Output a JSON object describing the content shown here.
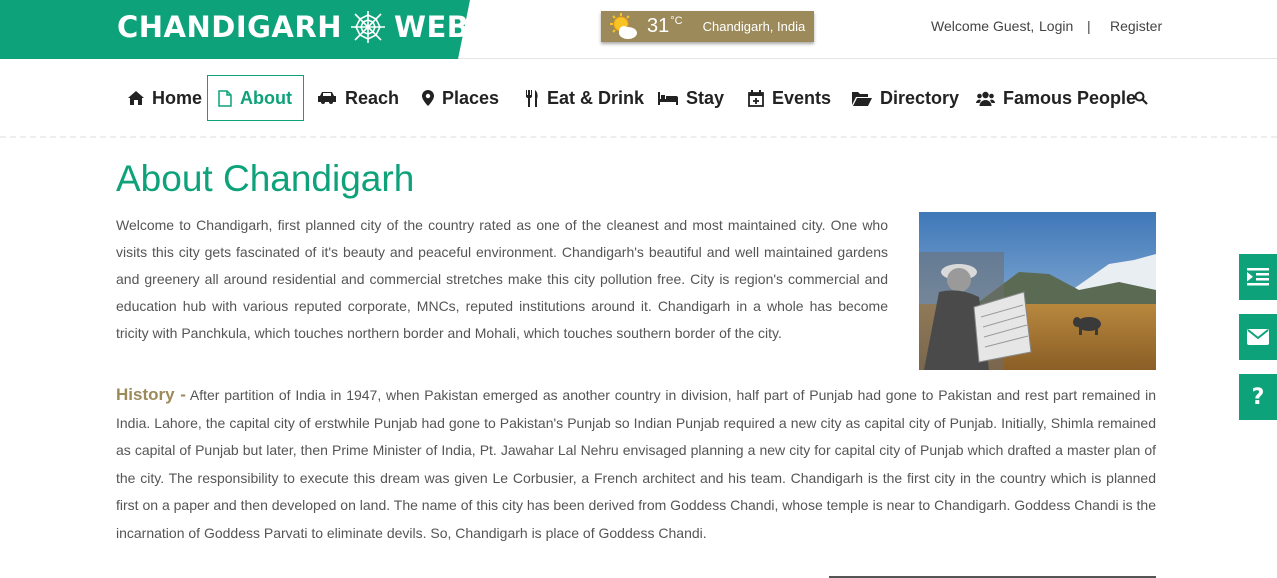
{
  "header": {
    "logo_left": "CHANDIGARH",
    "logo_right": "WEB",
    "weather": {
      "temperature": "31",
      "unit": "°C",
      "location": "Chandigarh, India"
    },
    "welcome": "Welcome Guest,",
    "login": "Login",
    "separator": "|",
    "register": "Register"
  },
  "nav": {
    "items": [
      {
        "label": "Home",
        "icon": "home-icon"
      },
      {
        "label": "About",
        "icon": "document-icon",
        "active": true
      },
      {
        "label": "Reach",
        "icon": "car-icon"
      },
      {
        "label": "Places",
        "icon": "map-marker-icon"
      },
      {
        "label": "Eat & Drink",
        "icon": "cutlery-icon"
      },
      {
        "label": "Stay",
        "icon": "bed-icon"
      },
      {
        "label": "Events",
        "icon": "calendar-plus-icon"
      },
      {
        "label": "Directory",
        "icon": "folder-open-icon"
      },
      {
        "label": "Famous People",
        "icon": "users-icon"
      }
    ],
    "search_icon": "search-icon"
  },
  "main": {
    "title": "About Chandigarh",
    "intro": "Welcome to Chandigarh, first planned city of the country rated as one of the cleanest and most maintained city. One who visits this city gets fascinated of it's beauty and peaceful environment. Chandigarh's beautiful and well maintained gardens and greenery all around residential and commercial stretches make this city pollution free. City is region's commercial and education hub with various reputed corporate, MNCs, reputed institutions around it. Chandigarh in a whole has become tricity with Panchkula, which touches northern border and Mohali, which touches southern border of the city.",
    "history_heading": "History -",
    "history_text": "After partition of India in 1947, when Pakistan emerged as another country in division, half part of Punjab had gone to Pakistan and rest part remained in India. Lahore, the capital city of erstwhile Punjab had gone to Pakistan's Punjab so Indian Punjab required a new city as capital city of Punjab. Initially, Shimla remained as capital of Punjab but later, then Prime Minister of India, Pt. Jawahar Lal Nehru envisaged planning a new city for capital city of Punjab which drafted a master plan of the city. The responsibility to execute this dream was given Le Corbusier, a French architect and his team. Chandigarh is the first city in the country which is planned first on a paper and then developed on land. The name of this city has been derived from Goddess Chandi, whose temple is near to Chandigarh. Goddess Chandi is the incarnation of Goddess Parvati to eliminate devils. So, Chandigarh is place of Goddess Chandi."
  },
  "side_buttons": {
    "feed_icon": "list-indent-icon",
    "mail_icon": "envelope-icon",
    "help_label": "?"
  },
  "colors": {
    "brand": "#0ea27a",
    "accent": "#9c8a5a"
  }
}
